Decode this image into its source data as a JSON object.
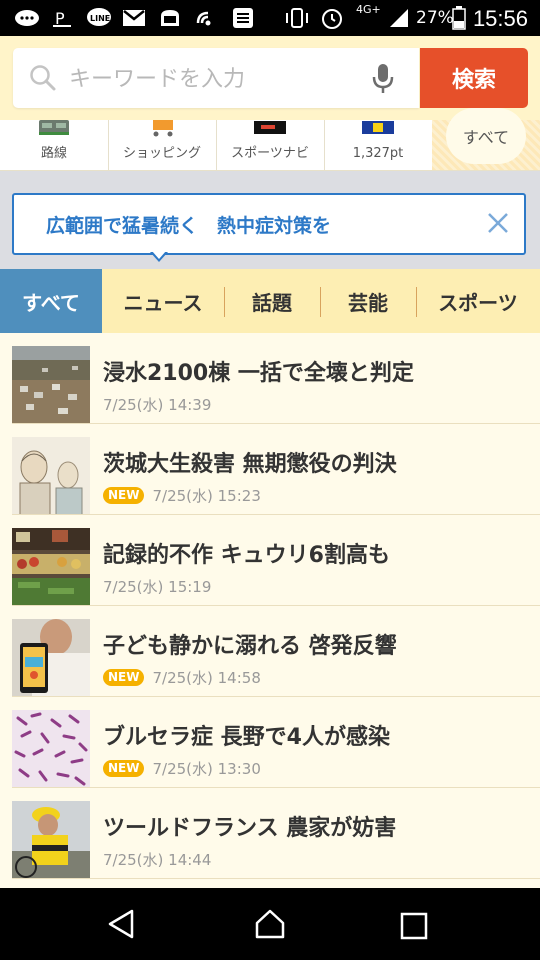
{
  "status_bar": {
    "battery": "27%",
    "network": "4G+",
    "time": "15:56",
    "app_icons": [
      "chat-bubbles-icon",
      "parking-icon",
      "line-icon",
      "gmail-icon",
      "toast-icon",
      "wifi-call-icon",
      "list-app-icon"
    ],
    "right_icons": [
      "vibrate-icon",
      "alarm-icon",
      "signal-icon",
      "battery-icon"
    ]
  },
  "search": {
    "placeholder": "キーワードを入力",
    "button_label": "検索"
  },
  "quick_links": [
    {
      "label": "路線",
      "icon": "train-icon"
    },
    {
      "label": "ショッピング",
      "icon": "cart-icon"
    },
    {
      "label": "スポーツナビ",
      "icon": "sportsnavi-icon"
    },
    {
      "label": "1,327pt",
      "icon": "tpoint-icon"
    }
  ],
  "quick_links_all": "すべて",
  "alert": {
    "text": "広範囲で猛暑続く　熱中症対策を"
  },
  "tabs": [
    {
      "label": "すべて",
      "active": true
    },
    {
      "label": "ニュース",
      "active": false
    },
    {
      "label": "話題",
      "active": false
    },
    {
      "label": "芸能",
      "active": false
    },
    {
      "label": "スポーツ",
      "active": false
    }
  ],
  "news": [
    {
      "headline": "浸水2100棟 一括で全壊と判定",
      "date": "7/25(水) 14:39",
      "badge": "",
      "thumb": "flood"
    },
    {
      "headline": "茨城大生殺害 無期懲役の判決",
      "date": "7/25(水) 15:23",
      "badge": "NEW",
      "thumb": "sketch"
    },
    {
      "headline": "記録的不作 キュウリ6割高も",
      "date": "7/25(水) 15:19",
      "badge": "",
      "thumb": "market"
    },
    {
      "headline": "子ども静かに溺れる 啓発反響",
      "date": "7/25(水) 14:58",
      "badge": "NEW",
      "thumb": "phone"
    },
    {
      "headline": "ブルセラ症 長野で4人が感染",
      "date": "7/25(水) 13:30",
      "badge": "NEW",
      "thumb": "bacteria"
    },
    {
      "headline": "ツールドフランス 農家が妨害",
      "date": "7/25(水) 14:44",
      "badge": "",
      "thumb": "cyclist"
    }
  ],
  "colors": {
    "search_button": "#e6502a",
    "accent_blue": "#2d79c7",
    "active_tab": "#4f8fbd",
    "new_badge": "#f5b100"
  }
}
